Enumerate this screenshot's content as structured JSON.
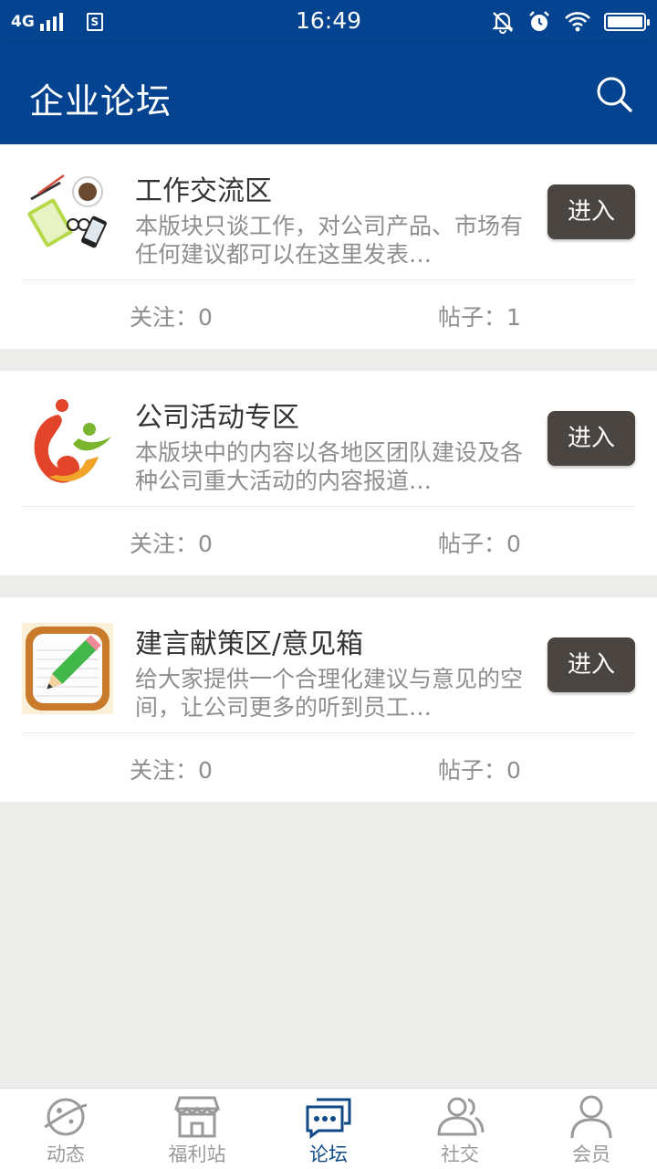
{
  "status_bar": {
    "network": "4G",
    "sim_label": "S",
    "time": "16:49"
  },
  "header": {
    "title": "企业论坛",
    "search_icon": "search-icon"
  },
  "colors": {
    "header_bg": "#04438f",
    "enter_button_bg": "#4a4540",
    "active_tab": "#104a86",
    "inactive_tab": "#9a9a9a",
    "page_bg": "#ececea"
  },
  "forums": [
    {
      "name": "工作交流区",
      "description": "本版块只谈工作，对公司产品、市场有任何建议都可以在这里发表…",
      "enter_label": "进入",
      "follow_label": "关注：0",
      "posts_label": "帖子：1",
      "logo": "office-supplies-icon"
    },
    {
      "name": "公司活动专区",
      "description": "本版块中的内容以各地区团队建设及各种公司重大活动的内容报道…",
      "enter_label": "进入",
      "follow_label": "关注：0",
      "posts_label": "帖子：0",
      "logo": "company-logo-icon"
    },
    {
      "name": "建言献策区/意见箱",
      "description": "给大家提供一个合理化建议与意见的空间，让公司更多的听到员工…",
      "enter_label": "进入",
      "follow_label": "关注：0",
      "posts_label": "帖子：0",
      "logo": "notepad-pencil-icon"
    }
  ],
  "tabs": [
    {
      "label": "动态",
      "icon": "planet-icon",
      "active": false
    },
    {
      "label": "福利站",
      "icon": "shop-icon",
      "active": false
    },
    {
      "label": "论坛",
      "icon": "chat-bubbles-icon",
      "active": true
    },
    {
      "label": "社交",
      "icon": "people-icon",
      "active": false
    },
    {
      "label": "会员",
      "icon": "person-icon",
      "active": false
    }
  ]
}
